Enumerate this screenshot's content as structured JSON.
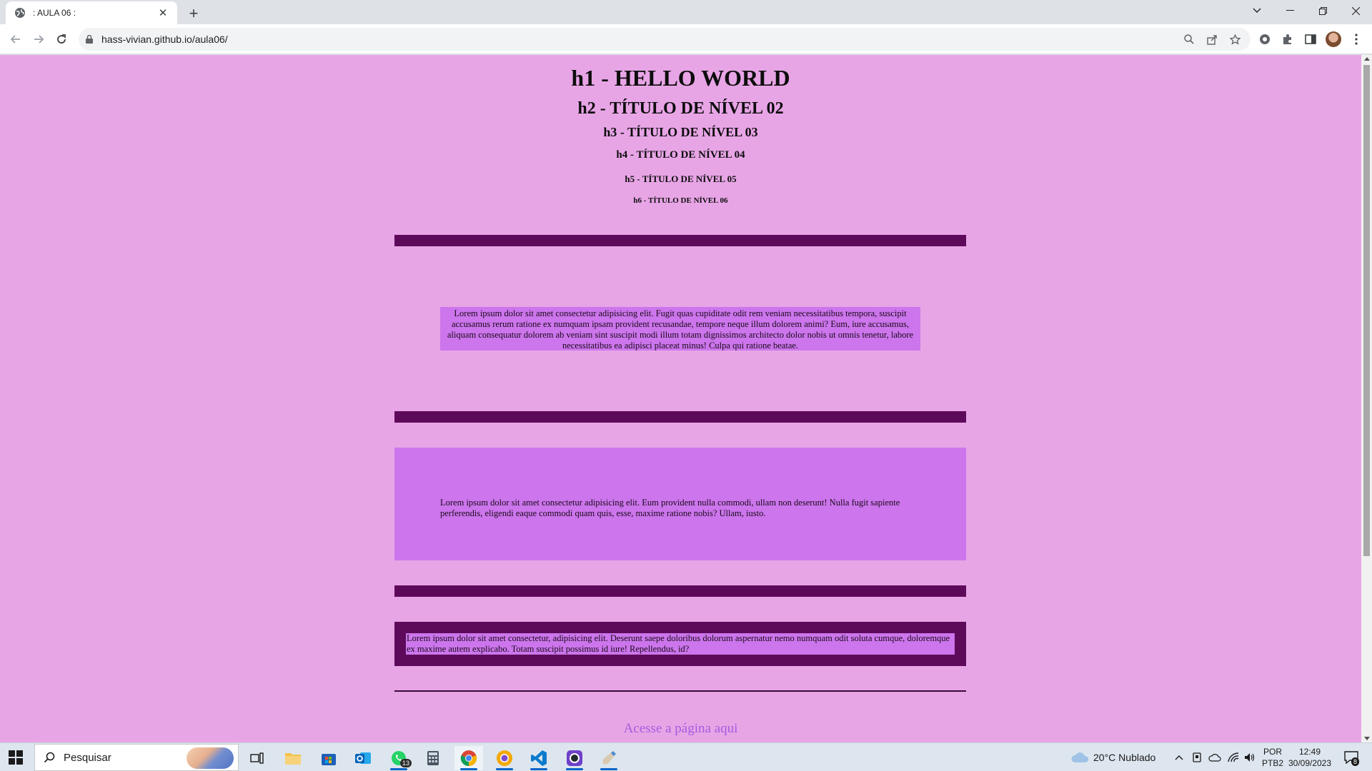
{
  "browser": {
    "tab_title": ": AULA 06 :",
    "url": "hass-vivian.github.io/aula06/"
  },
  "page": {
    "h1": "h1 - HELLO WORLD",
    "h2": "h2 - TÍTULO DE NÍVEL 02",
    "h3": "h3 - TÍTULO DE NÍVEL 03",
    "h4": "h4 - TÍTULO DE NÍVEL 04",
    "h5": "h5 - TÍTULO DE NÍVEL 05",
    "h6": "h6 - TÍTULO DE NÍVEL 06",
    "paragraph1": "Lorem ipsum dolor sit amet consectetur adipisicing elit. Fugit quas cupiditate odit rem veniam necessitatibus tempora, suscipit accusamus rerum ratione ex numquam ipsam provident recusandae, tempore neque illum dolorem animi? Eum, iure accusamus, aliquam consequatur dolorem ab veniam sint suscipit modi illum totam dignissimos architecto dolor nobis ut omnis tenetur, labore necessitatibus ea adipisci placeat minus! Culpa qui ratione beatae.",
    "paragraph2": "Lorem ipsum dolor sit amet consectetur adipisicing elit. Eum provident nulla commodi, ullam non deserunt! Nulla fugit sapiente perferendis, eligendi eaque commodi quam quis, esse, maxime ratione nobis? Ullam, iusto.",
    "paragraph3": "Lorem ipsum dolor sit amet consectetur, adipisicing elit. Deserunt saepe doloribus dolorum aspernatur nemo numquam odit soluta cumque, doloremque ex maxime autem explicabo. Totam suscipit possimus id iure! Repellendus, id?",
    "link": "Acesse a página aqui",
    "colors": {
      "background": "#e8a5e6",
      "bar": "#5e0a5b",
      "box": "#cc75ec",
      "link": "#a35ddf"
    }
  },
  "taskbar": {
    "search_placeholder": "Pesquisar",
    "whatsapp_badge": "13",
    "weather": "20°C  Nublado",
    "language": "POR",
    "keyboard": "PTB2",
    "time": "12:49",
    "date": "30/09/2023",
    "notifications": "8"
  }
}
